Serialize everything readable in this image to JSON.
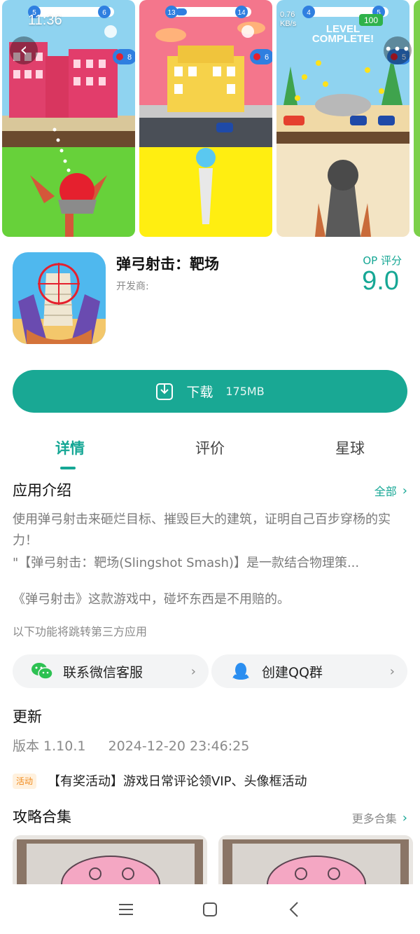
{
  "status_bar": {
    "time": "11:36",
    "speed": "0.76\nKB/s"
  },
  "screenshots": [
    {
      "hud_left": "5",
      "hud_right": "6",
      "badge": "8"
    },
    {
      "hud_left": "13",
      "hud_right": "14",
      "badge": "6"
    },
    {
      "hud_left": "4",
      "hud_right": "5",
      "badge": "5",
      "score": "100",
      "banner_line1": "LEVEL",
      "banner_line2": "COMPLETE!"
    }
  ],
  "app": {
    "title": "弹弓射击：靶场",
    "developer_label": "开发商:",
    "rating_label": "OP 评分",
    "rating_value": "9.0"
  },
  "download": {
    "label": "下载",
    "size": "175MB"
  },
  "tabs": [
    {
      "label": "详情",
      "active": true
    },
    {
      "label": "评价",
      "active": false
    },
    {
      "label": "星球",
      "active": false
    }
  ],
  "intro": {
    "title": "应用介绍",
    "more": "全部",
    "paragraph1": "使用弹弓射击来砸烂目标、摧毁巨大的建筑，证明自己百步穿杨的实力！",
    "paragraph2": "\"【弹弓射击：靶场(Slingshot Smash)】是一款结合物理策...",
    "paragraph3": "《弹弓射击》这款游戏中，碰坏东西是不用赔的。",
    "note": "以下功能将跳转第三方应用"
  },
  "service": {
    "wechat_label": "联系微信客服",
    "qq_label": "创建QQ群"
  },
  "update": {
    "title": "更新",
    "version": "版本 1.10.1",
    "date": "2024-12-20 23:46:25",
    "event_badge": "活动",
    "event_text": "【有奖活动】游戏日常评论领VIP、头像框活动"
  },
  "guides": {
    "title": "攻略合集",
    "more": "更多合集"
  },
  "colors": {
    "accent": "#19a894",
    "event": "#f08a1c"
  },
  "icons": [
    "back-icon",
    "more-icon",
    "download-icon",
    "chevron-right-icon",
    "wechat-icon",
    "qq-icon",
    "menu-icon",
    "home-icon",
    "back-nav-icon"
  ]
}
